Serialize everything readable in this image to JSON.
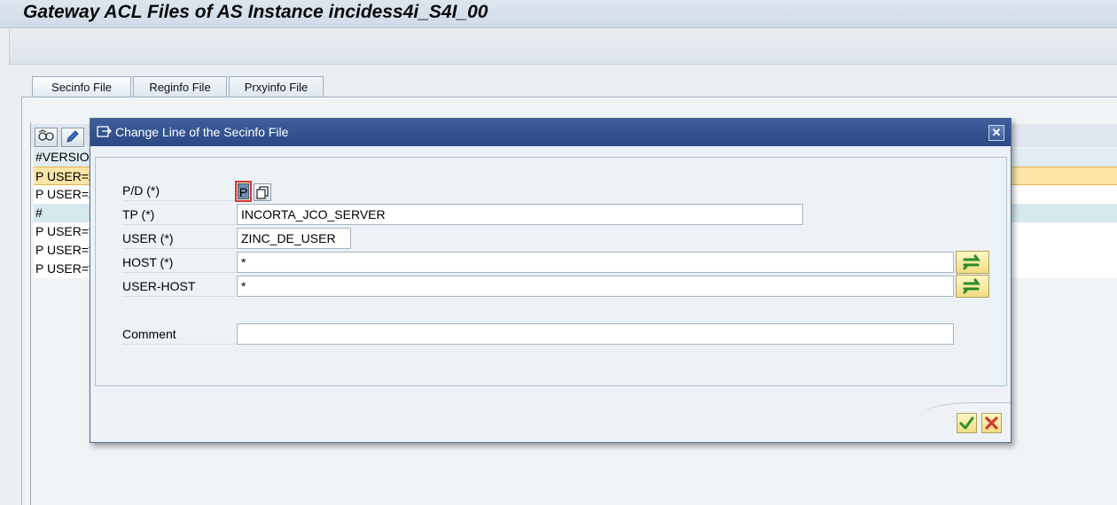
{
  "window": {
    "title": "Gateway ACL Files of AS Instance incidess4i_S4I_00"
  },
  "tabs": [
    {
      "label": "Secinfo File",
      "active": true
    },
    {
      "label": "Reginfo File",
      "active": false
    },
    {
      "label": "Prxyinfo File",
      "active": false
    }
  ],
  "grid": {
    "toolbar_icons": [
      "display-change-icon",
      "pencil-icon"
    ],
    "rows": [
      {
        "text": "#VERSIO",
        "state": "header"
      },
      {
        "text": "P USER=Z",
        "state": "selected"
      },
      {
        "text": "P USER=Z",
        "state": "plain"
      },
      {
        "text": "#",
        "state": "comment"
      },
      {
        "text": "P USER=*",
        "state": "plain"
      },
      {
        "text": "P USER=*",
        "state": "plain"
      },
      {
        "text": "P USER=*",
        "state": "plain"
      }
    ]
  },
  "dialog": {
    "title": "Change Line of the Secinfo File",
    "close_label": "✕",
    "fields": {
      "pd": {
        "label": "P/D (*)",
        "value": "P"
      },
      "tp": {
        "label": "TP (*)",
        "value": "INCORTA_JCO_SERVER"
      },
      "user": {
        "label": "USER (*)",
        "value": "ZINC_DE_USER"
      },
      "host": {
        "label": "HOST (*)",
        "value": "*"
      },
      "user_host": {
        "label": "USER-HOST",
        "value": "*"
      },
      "comment": {
        "label": "Comment",
        "value": ""
      }
    },
    "buttons": {
      "ok_icon": "checkmark-icon",
      "cancel_icon": "cancel-x-icon"
    }
  },
  "colors": {
    "title_bar": "#2a4883",
    "selected_row": "#fbe4a6",
    "focus_border": "#d6363b"
  }
}
